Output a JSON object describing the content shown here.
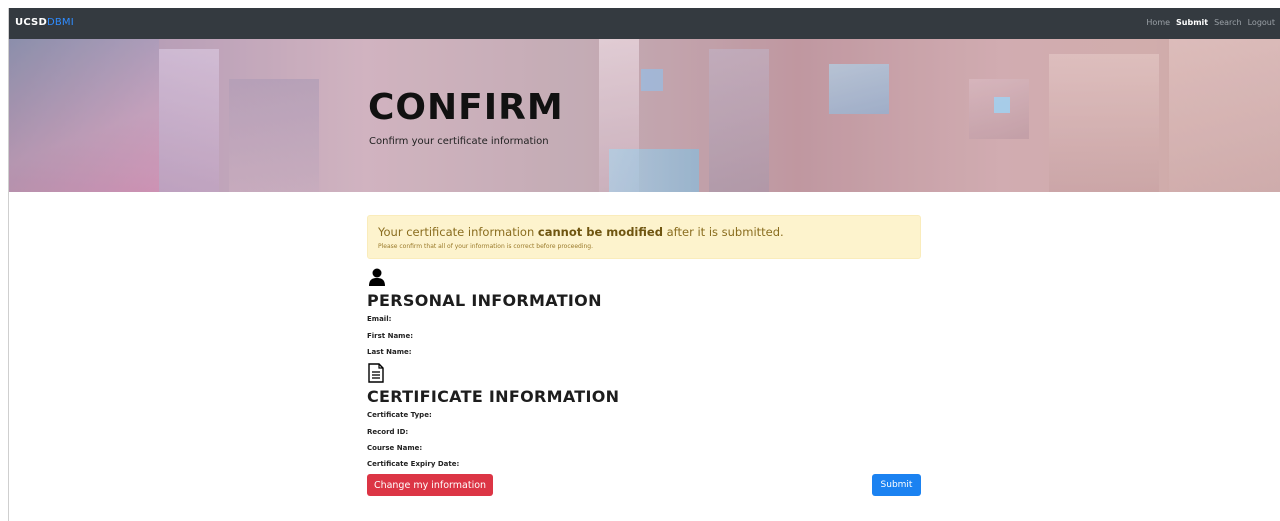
{
  "navbar": {
    "brand_main": "UCSD",
    "brand_accent": "DBMI",
    "links": [
      {
        "label": "Home",
        "active": false
      },
      {
        "label": "Submit",
        "active": true
      },
      {
        "label": "Search",
        "active": false
      },
      {
        "label": "Logout",
        "active": false
      }
    ]
  },
  "hero": {
    "title": "CONFIRM",
    "subtitle": "Confirm your certificate information"
  },
  "alert": {
    "text_before": "Your certificate information ",
    "text_bold": "cannot be modified",
    "text_after": " after it is submitted.",
    "subtext": "Please confirm that all of your information is correct before proceeding."
  },
  "personal": {
    "icon": "user-icon",
    "title": "PERSONAL INFORMATION",
    "fields": [
      "Email:",
      "First Name:",
      "Last Name:"
    ]
  },
  "certificate": {
    "icon": "document-icon",
    "title": "CERTIFICATE INFORMATION",
    "fields": [
      "Certificate Type:",
      "Record ID:",
      "Course Name:",
      "Certificate Expiry Date:"
    ]
  },
  "buttons": {
    "change_label": "Change my information",
    "submit_label": "Submit"
  },
  "colors": {
    "navbar": "#343a40",
    "brand_accent": "#2f8cff",
    "alert_bg": "#fdf3cd",
    "danger": "#dc3545",
    "primary": "#1b82f1"
  }
}
